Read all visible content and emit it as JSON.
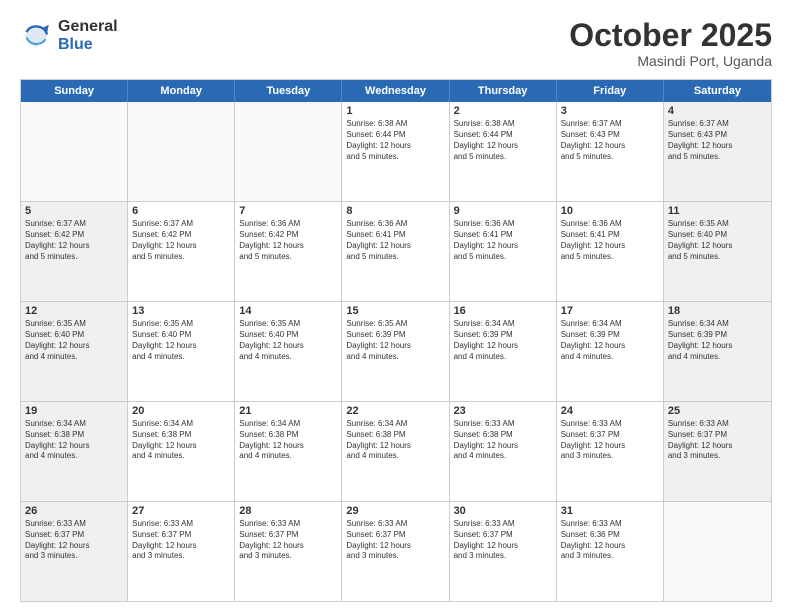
{
  "logo": {
    "general": "General",
    "blue": "Blue"
  },
  "title": "October 2025",
  "subtitle": "Masindi Port, Uganda",
  "days": [
    "Sunday",
    "Monday",
    "Tuesday",
    "Wednesday",
    "Thursday",
    "Friday",
    "Saturday"
  ],
  "rows": [
    [
      {
        "day": "",
        "text": "",
        "empty": true
      },
      {
        "day": "",
        "text": "",
        "empty": true
      },
      {
        "day": "",
        "text": "",
        "empty": true
      },
      {
        "day": "1",
        "text": "Sunrise: 6:38 AM\nSunset: 6:44 PM\nDaylight: 12 hours\nand 5 minutes."
      },
      {
        "day": "2",
        "text": "Sunrise: 6:38 AM\nSunset: 6:44 PM\nDaylight: 12 hours\nand 5 minutes."
      },
      {
        "day": "3",
        "text": "Sunrise: 6:37 AM\nSunset: 6:43 PM\nDaylight: 12 hours\nand 5 minutes."
      },
      {
        "day": "4",
        "text": "Sunrise: 6:37 AM\nSunset: 6:43 PM\nDaylight: 12 hours\nand 5 minutes.",
        "shaded": true
      }
    ],
    [
      {
        "day": "5",
        "text": "Sunrise: 6:37 AM\nSunset: 6:42 PM\nDaylight: 12 hours\nand 5 minutes.",
        "shaded": true
      },
      {
        "day": "6",
        "text": "Sunrise: 6:37 AM\nSunset: 6:42 PM\nDaylight: 12 hours\nand 5 minutes."
      },
      {
        "day": "7",
        "text": "Sunrise: 6:36 AM\nSunset: 6:42 PM\nDaylight: 12 hours\nand 5 minutes."
      },
      {
        "day": "8",
        "text": "Sunrise: 6:36 AM\nSunset: 6:41 PM\nDaylight: 12 hours\nand 5 minutes."
      },
      {
        "day": "9",
        "text": "Sunrise: 6:36 AM\nSunset: 6:41 PM\nDaylight: 12 hours\nand 5 minutes."
      },
      {
        "day": "10",
        "text": "Sunrise: 6:36 AM\nSunset: 6:41 PM\nDaylight: 12 hours\nand 5 minutes."
      },
      {
        "day": "11",
        "text": "Sunrise: 6:35 AM\nSunset: 6:40 PM\nDaylight: 12 hours\nand 5 minutes.",
        "shaded": true
      }
    ],
    [
      {
        "day": "12",
        "text": "Sunrise: 6:35 AM\nSunset: 6:40 PM\nDaylight: 12 hours\nand 4 minutes.",
        "shaded": true
      },
      {
        "day": "13",
        "text": "Sunrise: 6:35 AM\nSunset: 6:40 PM\nDaylight: 12 hours\nand 4 minutes."
      },
      {
        "day": "14",
        "text": "Sunrise: 6:35 AM\nSunset: 6:40 PM\nDaylight: 12 hours\nand 4 minutes."
      },
      {
        "day": "15",
        "text": "Sunrise: 6:35 AM\nSunset: 6:39 PM\nDaylight: 12 hours\nand 4 minutes."
      },
      {
        "day": "16",
        "text": "Sunrise: 6:34 AM\nSunset: 6:39 PM\nDaylight: 12 hours\nand 4 minutes."
      },
      {
        "day": "17",
        "text": "Sunrise: 6:34 AM\nSunset: 6:39 PM\nDaylight: 12 hours\nand 4 minutes."
      },
      {
        "day": "18",
        "text": "Sunrise: 6:34 AM\nSunset: 6:39 PM\nDaylight: 12 hours\nand 4 minutes.",
        "shaded": true
      }
    ],
    [
      {
        "day": "19",
        "text": "Sunrise: 6:34 AM\nSunset: 6:38 PM\nDaylight: 12 hours\nand 4 minutes.",
        "shaded": true
      },
      {
        "day": "20",
        "text": "Sunrise: 6:34 AM\nSunset: 6:38 PM\nDaylight: 12 hours\nand 4 minutes."
      },
      {
        "day": "21",
        "text": "Sunrise: 6:34 AM\nSunset: 6:38 PM\nDaylight: 12 hours\nand 4 minutes."
      },
      {
        "day": "22",
        "text": "Sunrise: 6:34 AM\nSunset: 6:38 PM\nDaylight: 12 hours\nand 4 minutes."
      },
      {
        "day": "23",
        "text": "Sunrise: 6:33 AM\nSunset: 6:38 PM\nDaylight: 12 hours\nand 4 minutes."
      },
      {
        "day": "24",
        "text": "Sunrise: 6:33 AM\nSunset: 6:37 PM\nDaylight: 12 hours\nand 3 minutes."
      },
      {
        "day": "25",
        "text": "Sunrise: 6:33 AM\nSunset: 6:37 PM\nDaylight: 12 hours\nand 3 minutes.",
        "shaded": true
      }
    ],
    [
      {
        "day": "26",
        "text": "Sunrise: 6:33 AM\nSunset: 6:37 PM\nDaylight: 12 hours\nand 3 minutes.",
        "shaded": true
      },
      {
        "day": "27",
        "text": "Sunrise: 6:33 AM\nSunset: 6:37 PM\nDaylight: 12 hours\nand 3 minutes."
      },
      {
        "day": "28",
        "text": "Sunrise: 6:33 AM\nSunset: 6:37 PM\nDaylight: 12 hours\nand 3 minutes."
      },
      {
        "day": "29",
        "text": "Sunrise: 6:33 AM\nSunset: 6:37 PM\nDaylight: 12 hours\nand 3 minutes."
      },
      {
        "day": "30",
        "text": "Sunrise: 6:33 AM\nSunset: 6:37 PM\nDaylight: 12 hours\nand 3 minutes."
      },
      {
        "day": "31",
        "text": "Sunrise: 6:33 AM\nSunset: 6:36 PM\nDaylight: 12 hours\nand 3 minutes."
      },
      {
        "day": "",
        "text": "",
        "empty": true
      }
    ]
  ]
}
